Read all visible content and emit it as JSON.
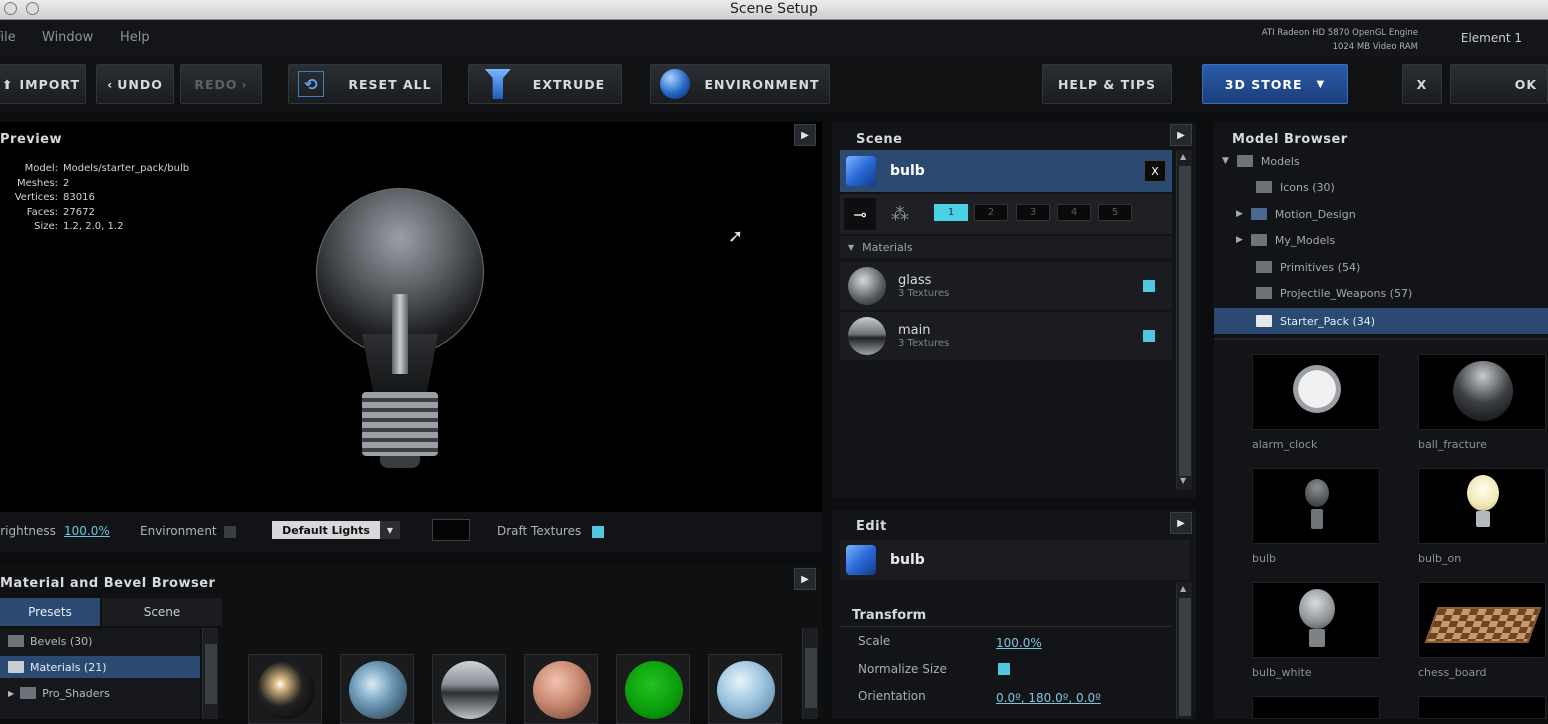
{
  "window": {
    "title": "Scene Setup"
  },
  "menu": {
    "items": [
      "File",
      "Window",
      "Help"
    ],
    "gpu_line1": "ATI Radeon HD 5870 OpenGL Engine",
    "gpu_line2": "1024 MB Video RAM",
    "element_label": "Element 1"
  },
  "toolbar": {
    "import": "IMPORT",
    "undo": "UNDO",
    "redo": "REDO",
    "reset_all": "RESET ALL",
    "extrude": "EXTRUDE",
    "environment": "ENVIRONMENT",
    "help_tips": "HELP & TIPS",
    "store": "3D STORE",
    "close": "X",
    "ok": "OK"
  },
  "preview": {
    "title": "Preview",
    "info": [
      {
        "k": "Model:",
        "v": "Models/starter_pack/bulb"
      },
      {
        "k": "Meshes:",
        "v": "2"
      },
      {
        "k": "Vertices:",
        "v": "83016"
      },
      {
        "k": "Faces:",
        "v": "27672"
      },
      {
        "k": "Size:",
        "v": "1.2, 2.0, 1.2"
      }
    ],
    "brightness_label": "Brightness",
    "brightness_value": "100.0%",
    "environment_label": "Environment",
    "lights_value": "Default Lights",
    "draft_label": "Draft Textures"
  },
  "material_browser": {
    "title": "Material and Bevel Browser",
    "tabs": [
      "Presets",
      "Scene"
    ],
    "folders": [
      "Bevels (30)",
      "Materials (21)",
      "Pro_Shaders"
    ]
  },
  "scene": {
    "title": "Scene",
    "object_name": "bulb",
    "close": "X",
    "slots": [
      "1",
      "2",
      "3",
      "4",
      "5"
    ],
    "materials_header": "Materials",
    "materials": [
      {
        "name": "glass",
        "sub": "3 Textures"
      },
      {
        "name": "main",
        "sub": "3 Textures"
      }
    ]
  },
  "edit": {
    "title": "Edit",
    "object_name": "bulb",
    "section": "Transform",
    "props": [
      {
        "label": "Scale",
        "value": "100.0%"
      },
      {
        "label": "Normalize Size",
        "value": ""
      },
      {
        "label": "Orientation",
        "value": "0.0º, 180.0º, 0.0º"
      }
    ]
  },
  "model_browser": {
    "title": "Model Browser",
    "tree": [
      "Models",
      "Icons (30)",
      "Motion_Design",
      "My_Models",
      "Primitives (54)",
      "Projectile_Weapons (57)",
      "Starter_Pack (34)"
    ],
    "models": [
      "alarm_clock",
      "ball_fracture",
      "bulb",
      "bulb_on",
      "bulb_white",
      "chess_board"
    ]
  },
  "colors": {
    "accent": "#4ad1e6",
    "selection": "#2a4a72",
    "store_blue": "#2a5ca8"
  }
}
